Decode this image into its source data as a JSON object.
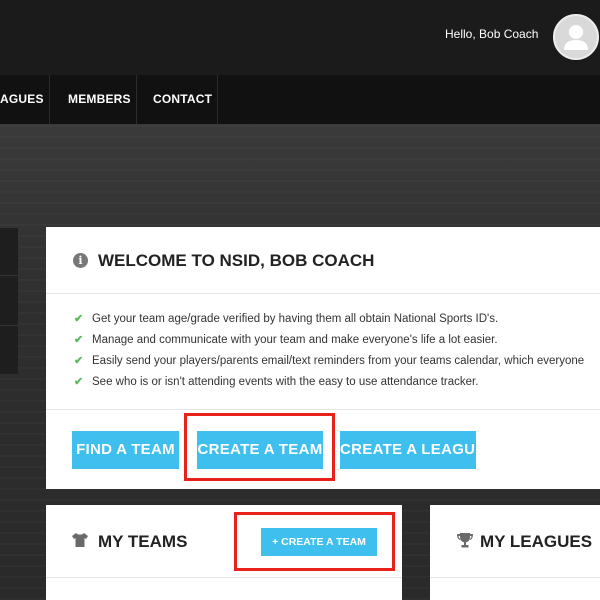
{
  "header": {
    "greeting": "Hello, Bob Coach"
  },
  "nav": {
    "items": [
      "AGUES",
      "MEMBERS",
      "CONTACT"
    ]
  },
  "welcome": {
    "title": "WELCOME TO NSID, BOB COACH",
    "bullets": [
      "Get your team age/grade verified by having them all obtain National Sports ID's.",
      "Manage and communicate with your team and make everyone's life a lot easier.",
      "Easily send your players/parents email/text reminders from your teams calendar, which everyone",
      "See who is or isn't attending events with the easy to use attendance tracker."
    ],
    "buttons": {
      "find_team": "FIND A TEAM",
      "create_team": "CREATE A TEAM",
      "create_league": "CREATE A LEAGUE"
    }
  },
  "my_teams": {
    "title": "MY TEAMS",
    "create_button": "+ CREATE A TEAM"
  },
  "my_leagues": {
    "title": "MY LEAGUES"
  },
  "colors": {
    "accent": "#3fbfee",
    "highlight": "#e8221b",
    "check": "#5cb85c"
  }
}
